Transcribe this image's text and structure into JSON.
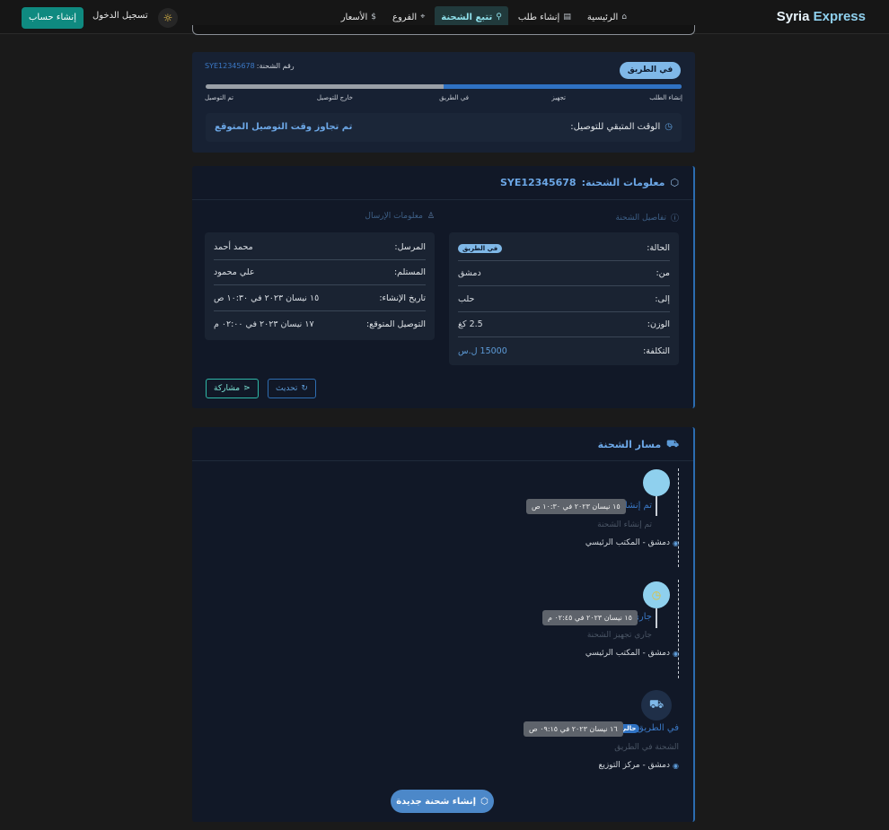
{
  "brand": {
    "part1": "Syria",
    "part2": " Express"
  },
  "nav": {
    "items": [
      {
        "label": "الرئيسية",
        "icon": "home-icon"
      },
      {
        "label": "إنشاء طلب",
        "icon": "document-icon"
      },
      {
        "label": "تتبع الشحنة",
        "icon": "search-icon",
        "active": true
      },
      {
        "label": "الفروع",
        "icon": "location-pin-icon"
      },
      {
        "label": "الأسعار",
        "icon": "dollar-icon"
      }
    ],
    "login": "تسجيل الدخول",
    "signup": "إنشاء حساب",
    "theme_icon": "sun-icon"
  },
  "status": {
    "pill": "في الطريق",
    "tracking_label": "رقم الشحنة:",
    "tracking_number": "SYE12345678",
    "progress": 0.5,
    "steps": [
      "إنشاء الطلب",
      "تجهيز",
      "في الطريق",
      "خارج للتوصيل",
      "تم التوصيل"
    ],
    "eta_label": "الوقت المتبقي للتوصيل:",
    "eta_value": "تم تجاوز وقت التوصيل المتوقع"
  },
  "info": {
    "title": "معلومات الشحنة:",
    "tracking_number": "SYE12345678",
    "details_title": "تفاصيل الشحنة",
    "details": [
      {
        "key": "الحالة:",
        "value": "في الطريق"
      },
      {
        "key": "من:",
        "value": "دمشق"
      },
      {
        "key": "إلى:",
        "value": "حلب"
      },
      {
        "key": "الوزن:",
        "value": "2.5 كغ"
      },
      {
        "key": "التكلفة:",
        "value": "15000 ل.س"
      }
    ],
    "sender_title": "معلومات الإرسال",
    "sender": [
      {
        "key": "المرسل:",
        "value": "محمد أحمد"
      },
      {
        "key": "المستلم:",
        "value": "علي محمود"
      },
      {
        "key": "تاريخ الإنشاء:",
        "value": "١٥ نيسان ٢٠٢٣ في ١٠:٣٠ ص"
      },
      {
        "key": "التوصيل المتوقع:",
        "value": "١٧ نيسان ٢٠٢٣ في ٠٢:٠٠ م"
      }
    ],
    "refresh": "تحديث",
    "share": "مشاركة"
  },
  "route": {
    "title": "مسار الشحنة",
    "events": [
      {
        "title": "تم إنشاء الشحنة",
        "time": "١٥ نيسان ٢٠٢٣ في ١٠:٣٠ ص",
        "desc": "تم إنشاء الشحنة",
        "location": "دمشق - المكتب الرئيسي",
        "icon": "check-icon"
      },
      {
        "title": "جاري التجهيز",
        "time": "١٥ نيسان ٢٠٢٣ في ٠٢:٤٥ م",
        "desc": "جاري تجهيز الشحنة",
        "location": "دمشق - المكتب الرئيسي",
        "icon": "clock-icon"
      },
      {
        "title": "في الطريق",
        "time": "١٦ نيسان ٢٠٢٣ في ٠٩:١٥ ص",
        "badge": "حالي",
        "desc": "الشحنة في الطريق",
        "location": "دمشق - مركز التوزيع",
        "icon": "truck-icon"
      }
    ],
    "new_button": "إنشاء شحنة جديدة"
  }
}
